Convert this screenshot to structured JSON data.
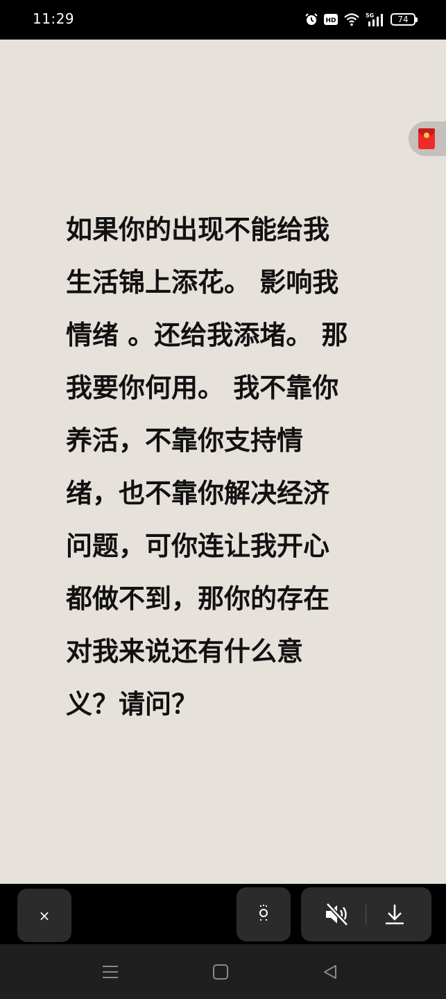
{
  "status_bar": {
    "time": "11:29",
    "network": "5G",
    "hd": "HD",
    "battery": "74",
    "icons": [
      "alarm-icon",
      "hd-icon",
      "wifi-icon",
      "signal-5g-icon",
      "battery-icon"
    ]
  },
  "quote": {
    "lines": [
      "如果你的出现不能给我",
      "生活锦上添花。 影响我",
      "情绪 。还给我添堵。 那",
      "我要你何用。 我不靠你",
      "养活，不靠你支持情",
      "绪，也不靠你解决经济",
      "问题，可你连让我开心",
      "都做不到，那你的存在",
      "对我来说还有什么意",
      "义？请问？"
    ]
  },
  "side_widget": {
    "icon": "red-envelope-icon"
  },
  "controls": {
    "close_label": "×",
    "icons": [
      "close-icon",
      "capture-icon",
      "mute-icon",
      "download-icon"
    ]
  },
  "nav": {
    "icons": [
      "menu-icon",
      "home-icon",
      "back-icon"
    ]
  },
  "colors": {
    "page_background": "#e7e1dc",
    "text": "#111111",
    "accent_red": "#ee2a2a"
  }
}
